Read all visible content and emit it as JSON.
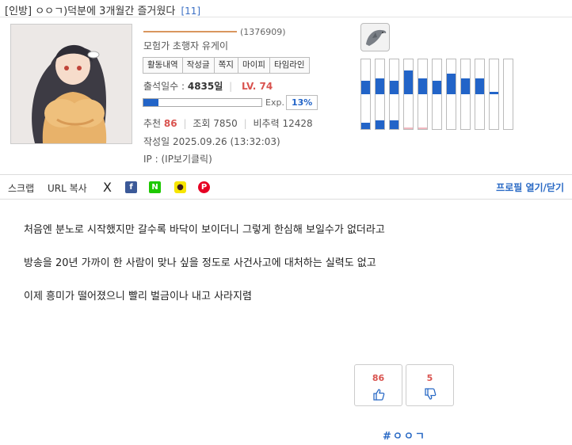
{
  "post": {
    "category": "[인방]",
    "title": "ㅇㅇㄱ)덕분에 3개월간 즐거웠다",
    "comment_count": "[11]"
  },
  "author": {
    "user_id": "(1376909)",
    "rank_title": "모험가 초행자 유게이",
    "menu": [
      "활동내역",
      "작성글",
      "쪽지",
      "마이피",
      "타임라인"
    ],
    "attendance_label": "출석일수 :",
    "attendance_value": "4835일",
    "level": "LV. 74",
    "exp_label": "Exp.",
    "exp_percent": "13%",
    "exp_fraction": 0.13,
    "recommend_label": "추천",
    "recommend_value": "86",
    "views_label": "조회",
    "views_value": "7850",
    "ratio_label": "비추력",
    "ratio_value": "12428",
    "date_label": "작성일",
    "date_value": "2025.09.26 (13:32:03)",
    "ip_label": "IP :",
    "ip_value": "(IP보기클릭)",
    "activity_levels": [
      {
        "upper": 0.55,
        "lower": 0.25
      },
      {
        "upper": 0.65,
        "lower": 0.35
      },
      {
        "upper": 0.55,
        "lower": 0.35
      },
      {
        "upper": 1.0,
        "lower": 0.0,
        "lower_color": "#f0b8c0"
      },
      {
        "upper": 0.65,
        "lower": 0.0,
        "lower_color": "#f0b8c0"
      },
      {
        "upper": 0.55,
        "lower": 0.0
      },
      {
        "upper": 0.85,
        "lower": 0.0
      },
      {
        "upper": 0.65,
        "lower": 0.0
      },
      {
        "upper": 0.65,
        "lower": 0.0
      },
      {
        "upper": 0.1,
        "lower": 0.0
      },
      {
        "upper": 0.0,
        "lower": 0.0
      }
    ]
  },
  "share": {
    "scrap": "스크랩",
    "url_copy": "URL 복사",
    "icons": [
      {
        "name": "x-icon",
        "glyph": "X",
        "color": "#222222"
      },
      {
        "name": "facebook-icon",
        "glyph": "f",
        "color": "#3b5998"
      },
      {
        "name": "naver-icon",
        "glyph": "N",
        "color": "#1ec800"
      },
      {
        "name": "kakaotalk-icon",
        "glyph": "●",
        "color": "#f7e600"
      },
      {
        "name": "pinterest-icon",
        "glyph": "P",
        "color": "#e60023"
      }
    ],
    "profile_toggle": "프로필 열기/닫기"
  },
  "content": {
    "lines": [
      "처음엔 분노로 시작했지만 갈수록 바닥이 보이더니 그렇게 한심해 보일수가 없더라고",
      "방송을 20년 가까이 한 사람이 맞나 싶을 정도로 사건사고에 대처하는 실력도 없고",
      "이제 흥미가 떨어졌으니 빨리 벌금이나 내고 사라지렴"
    ]
  },
  "votes": {
    "up": "86",
    "down": "5"
  },
  "hashtag": "#ㅇㅇㄱ",
  "colors": {
    "accent_blue": "#2264c8",
    "level_red": "#d9534f",
    "link_blue": "#2a6ac5"
  }
}
